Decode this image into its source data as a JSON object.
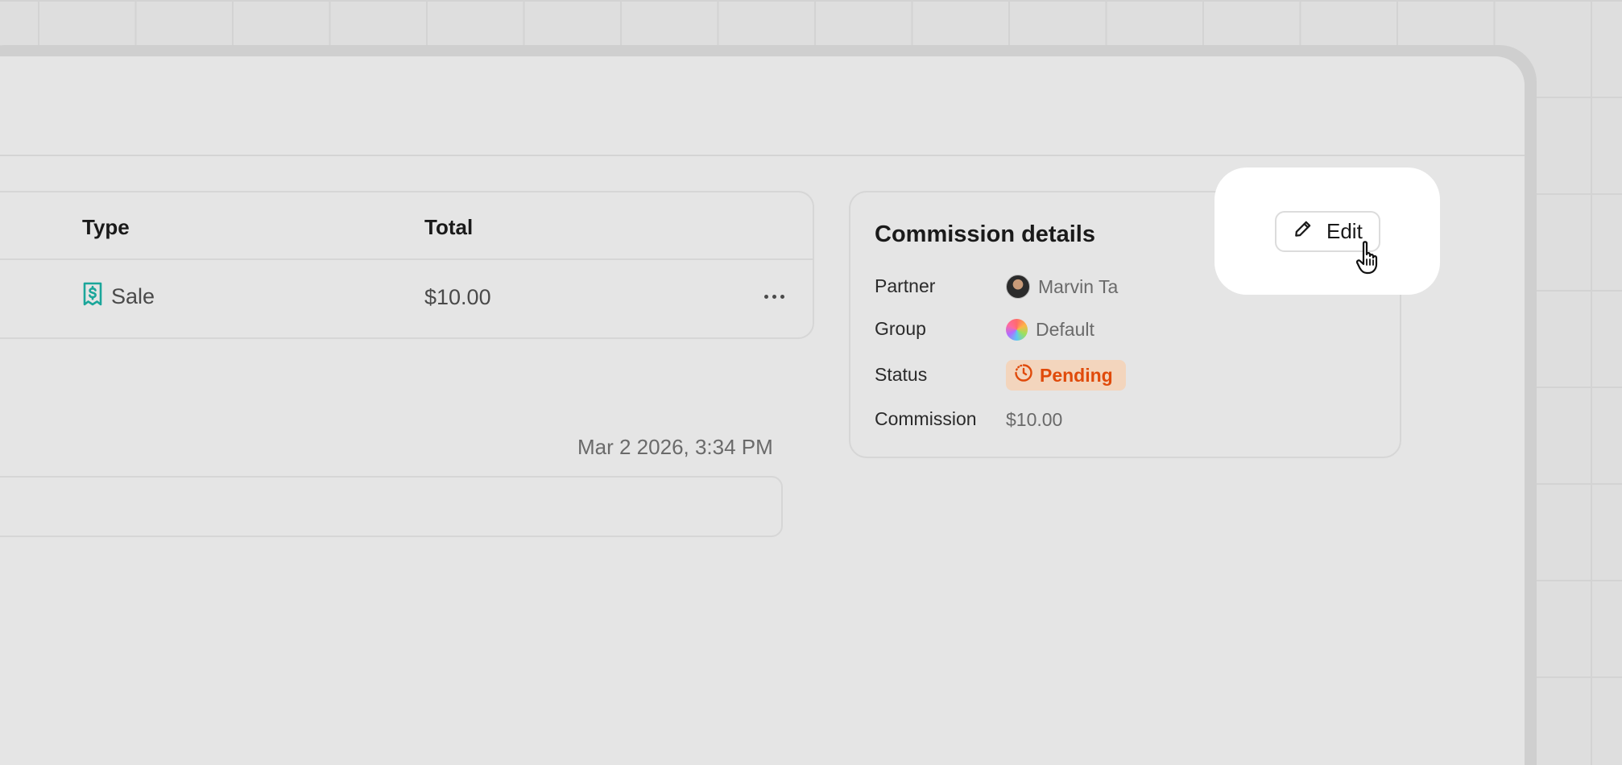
{
  "table": {
    "headers": {
      "type": "Type",
      "total": "Total"
    },
    "row": {
      "type": "Sale",
      "total": "$10.00"
    }
  },
  "activity": {
    "timestamp": "Mar 2 2026, 3:34 PM"
  },
  "commission": {
    "title": "Commission details",
    "edit_label": "Edit",
    "rows": [
      {
        "label": "Partner",
        "value": "Marvin Ta"
      },
      {
        "label": "Group",
        "value": "Default"
      },
      {
        "label": "Status",
        "value": "Pending"
      },
      {
        "label": "Commission",
        "value": "$10.00"
      }
    ]
  },
  "colors": {
    "accent_teal": "#1aa69a",
    "pending_text": "#e04a0a",
    "pending_bg": "#f3d5bd"
  },
  "icons": [
    "receipt-dollar-icon",
    "more-horizontal-icon",
    "pencil-icon",
    "clock-dashed-icon",
    "hand-pointer-icon"
  ]
}
